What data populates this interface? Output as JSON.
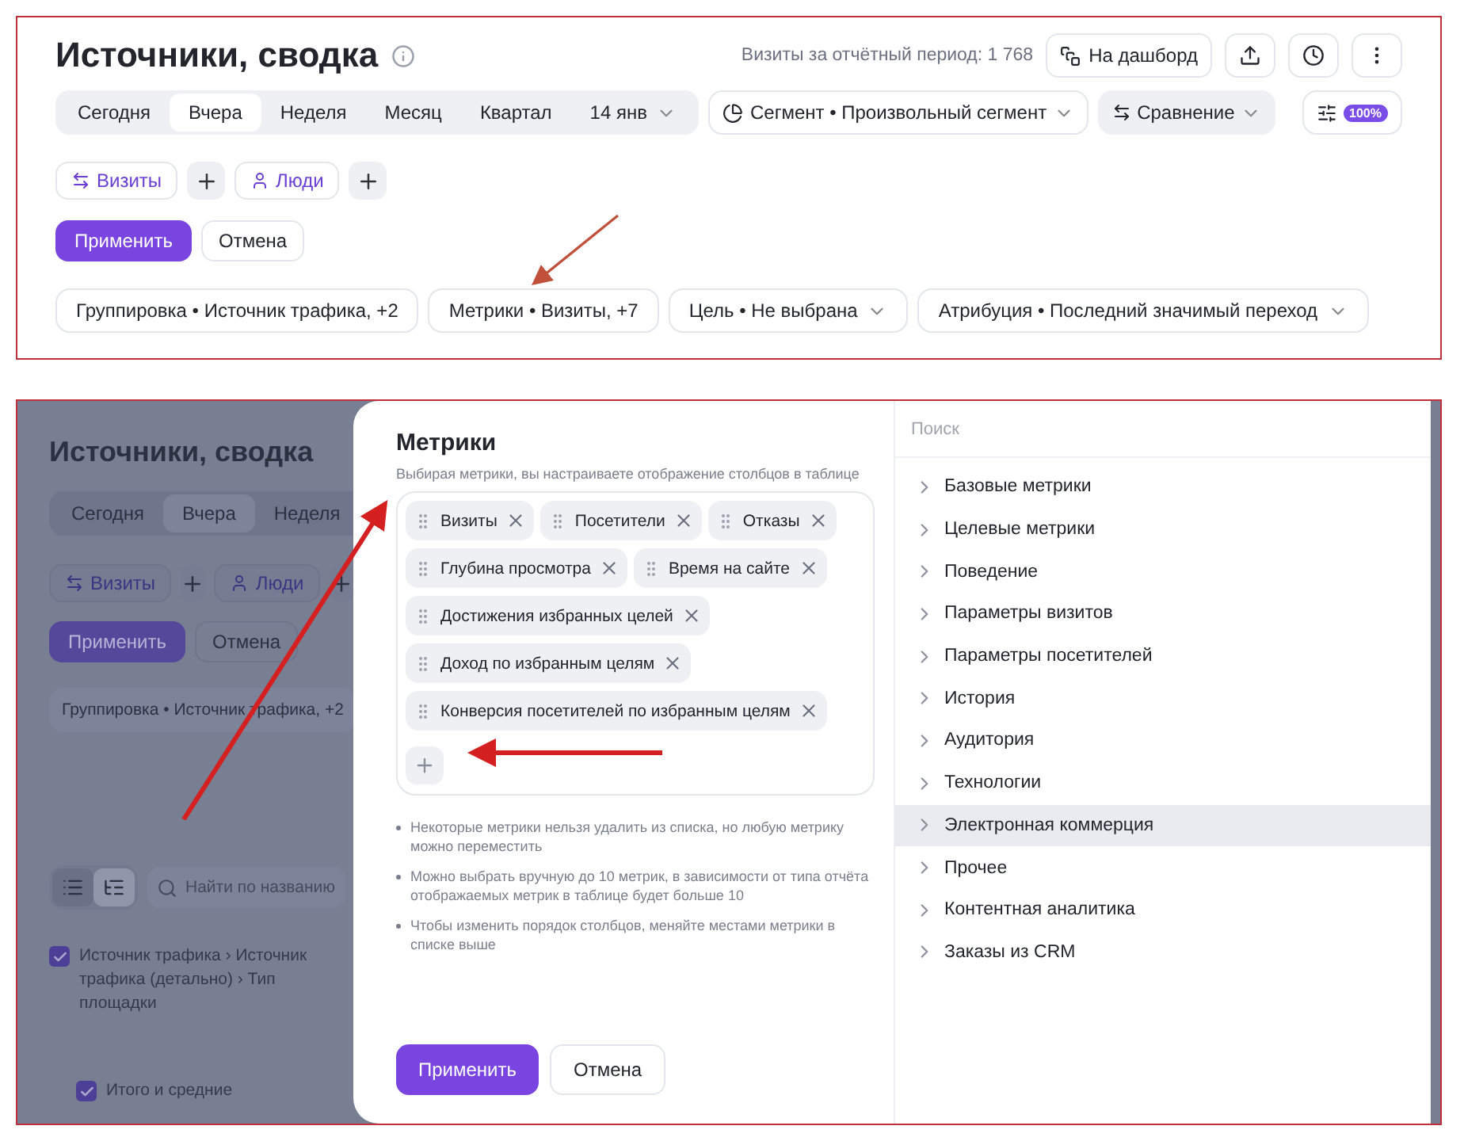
{
  "report": {
    "title": "Источники, сводка",
    "visits_summary": "Визиты за отчётный период: 1 768",
    "dashboard_button": "На дашборд",
    "periods": [
      {
        "label": "Сегодня",
        "selected": false
      },
      {
        "label": "Вчера",
        "selected": true
      },
      {
        "label": "Неделя",
        "selected": false
      },
      {
        "label": "Месяц",
        "selected": false
      },
      {
        "label": "Квартал",
        "selected": false
      }
    ],
    "date": "14 янв",
    "segment": "Сегмент • Произвольный сегмент",
    "comparison": "Сравнение",
    "sampling_badge": "100%",
    "chips": [
      {
        "kind": "visits",
        "label": "Визиты"
      },
      {
        "kind": "people",
        "label": "Люди"
      }
    ],
    "apply": "Применить",
    "cancel": "Отмена",
    "filters": [
      {
        "kind": "plain",
        "label": "Группировка • Источник трафика, +2"
      },
      {
        "kind": "plain",
        "label": "Метрики • Визиты, +7"
      },
      {
        "kind": "dropdown",
        "label": "Цель • Не выбрана"
      },
      {
        "kind": "dropdown",
        "label": "Атрибуция • Последний значимый переход"
      }
    ]
  },
  "dimmed_report": {
    "title": "Источники, сводка",
    "periods": [
      {
        "label": "Сегодня",
        "selected": false
      },
      {
        "label": "Вчера",
        "selected": true
      },
      {
        "label": "Неделя",
        "selected": false
      }
    ],
    "chips": [
      {
        "kind": "visits",
        "label": "Визиты"
      },
      {
        "kind": "people",
        "label": "Люди"
      }
    ],
    "apply": "Применить",
    "cancel": "Отмена",
    "grouping": "Группировка • Источник трафика, +2",
    "views": [
      {
        "kind": "flat",
        "selected": false
      },
      {
        "kind": "tree",
        "selected": true
      }
    ],
    "search_placeholder": "Найти по названию",
    "rows": [
      {
        "kind": "dimension",
        "label": "Источник трафика › Источник трафика (детально) › Тип площадки",
        "checked": true
      },
      {
        "kind": "total",
        "label": "Итого и средние",
        "checked": true
      }
    ]
  },
  "metrics_panel": {
    "title": "Метрики",
    "subtitle": "Выбирая метрики, вы настраиваете отображение столбцов в таблице",
    "metrics": [
      "Визиты",
      "Посетители",
      "Отказы",
      "Глубина просмотра",
      "Время на сайте",
      "Достижения избранных целей",
      "Доход по избранным целям",
      "Конверсия посетителей по избранным целям"
    ],
    "notes": [
      "Некоторые метрики нельзя удалить из списка, но любую метрику можно переместить",
      "Можно выбрать вручную до 10 метрик, в зависимости от типа отчёта отображаемых метрик в таблице будет больше 10",
      "Чтобы изменить порядок столбцов, меняйте местами метрики в списке выше"
    ],
    "apply": "Применить",
    "cancel": "Отмена"
  },
  "catalog": {
    "search_placeholder": "Поиск",
    "categories": [
      {
        "label": "Базовые метрики",
        "hovered": false
      },
      {
        "label": "Целевые метрики",
        "hovered": false
      },
      {
        "label": "Поведение",
        "hovered": false
      },
      {
        "label": "Параметры визитов",
        "hovered": false
      },
      {
        "label": "Параметры посетителей",
        "hovered": false
      },
      {
        "label": "История",
        "hovered": false
      },
      {
        "label": "Аудитория",
        "hovered": false
      },
      {
        "label": "Технологии",
        "hovered": false
      },
      {
        "label": "Электронная коммерция",
        "hovered": true
      },
      {
        "label": "Прочее",
        "hovered": false
      },
      {
        "label": "Контентная аналитика",
        "hovered": false
      },
      {
        "label": "Заказы из CRM",
        "hovered": false
      }
    ]
  }
}
